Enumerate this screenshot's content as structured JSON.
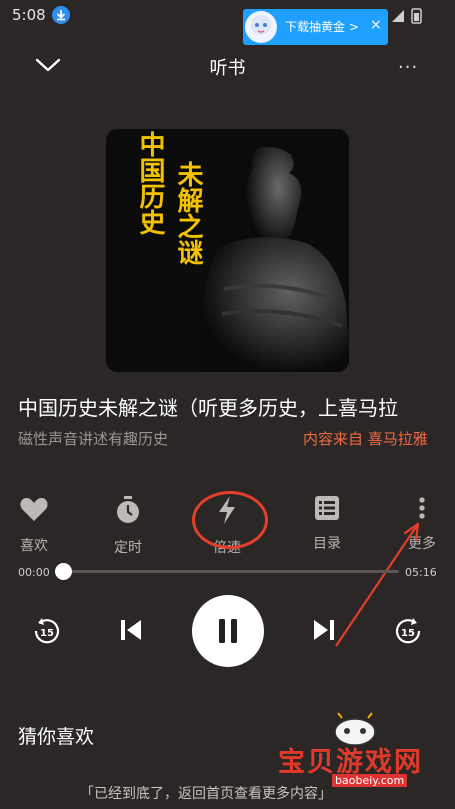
{
  "status_bar": {
    "time": "5:08"
  },
  "ad": {
    "text": "下载抽黄金 >",
    "close": "×"
  },
  "header": {
    "title": "听书",
    "more": "..."
  },
  "cover": {
    "title_col1": "中国历史",
    "title_col2": "未解之谜"
  },
  "album": {
    "title": "中国历史未解之谜（听更多历史，上喜马拉",
    "subtitle": "磁性声音讲述有趣历史",
    "source": "内容来自 喜马拉雅"
  },
  "actions": [
    {
      "label": "喜欢",
      "icon": "heart-icon"
    },
    {
      "label": "定时",
      "icon": "timer-icon"
    },
    {
      "label": "倍速",
      "icon": "lightning-icon"
    },
    {
      "label": "目录",
      "icon": "list-icon"
    },
    {
      "label": "更多",
      "icon": "more-vertical-icon"
    }
  ],
  "progress": {
    "current": "00:00",
    "total": "05:16",
    "fraction": 0.0
  },
  "controls": {
    "rewind_seconds": "15",
    "forward_seconds": "15"
  },
  "recommend": {
    "title": "猜你喜欢",
    "tip": "「已经到底了，返回首页查看更多内容」"
  },
  "watermark": {
    "name": "宝贝游戏网",
    "url": "baobeiy.com"
  },
  "colors": {
    "background": "#2a2726",
    "accent": "#f36a42",
    "annotation": "#e2402a"
  }
}
